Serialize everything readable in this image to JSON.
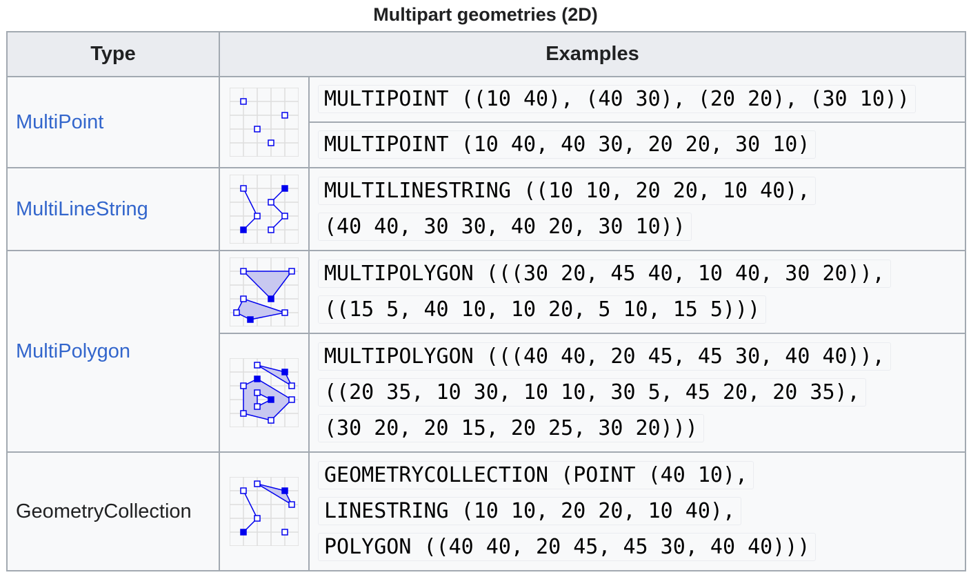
{
  "caption": "Multipart geometries (2D)",
  "headers": {
    "type": "Type",
    "examples": "Examples"
  },
  "rows": {
    "multipoint": {
      "type_label": "MultiPoint",
      "example1": "MULTIPOINT ((10 40), (40 30), (20 20), (30 10))",
      "example2": "MULTIPOINT (10 40, 40 30, 20 20, 30 10)"
    },
    "multilinestring": {
      "type_label": "MultiLineString",
      "example_line1": "MULTILINESTRING ((10 10, 20 20, 10 40),",
      "example_line2": "(40 40, 30 30, 40 20, 30 10))"
    },
    "multipolygon": {
      "type_label": "MultiPolygon",
      "example1_line1": "MULTIPOLYGON (((30 20, 45 40, 10 40, 30 20)),",
      "example1_line2": "((15 5, 40 10, 10 20, 5 10, 15 5)))",
      "example2_line1": "MULTIPOLYGON (((40 40, 20 45, 45 30, 40 40)),",
      "example2_line2": "((20 35, 10 30, 10 10, 30 5, 45 20, 20 35),",
      "example2_line3": "(30 20, 20 15, 20 25, 30 20)))"
    },
    "geometrycollection": {
      "type_label": "GeometryCollection",
      "example_line1": "GEOMETRYCOLLECTION (POINT (40 10),",
      "example_line2": "LINESTRING (10 10, 20 20, 10 40),",
      "example_line3": "POLYGON ((40 40, 20 45, 45 30, 40 40)))"
    }
  },
  "colors": {
    "link": "#3366cc",
    "geometry_stroke": "#0000ee",
    "geometry_fill": "#c8c8f0",
    "grid": "#dddddd",
    "header_bg": "#eaecf0",
    "border": "#a2a9b1"
  },
  "icons": [
    "multipoint-diagram",
    "multilinestring-diagram",
    "multipolygon-diagram-1",
    "multipolygon-diagram-2",
    "geometrycollection-diagram"
  ]
}
